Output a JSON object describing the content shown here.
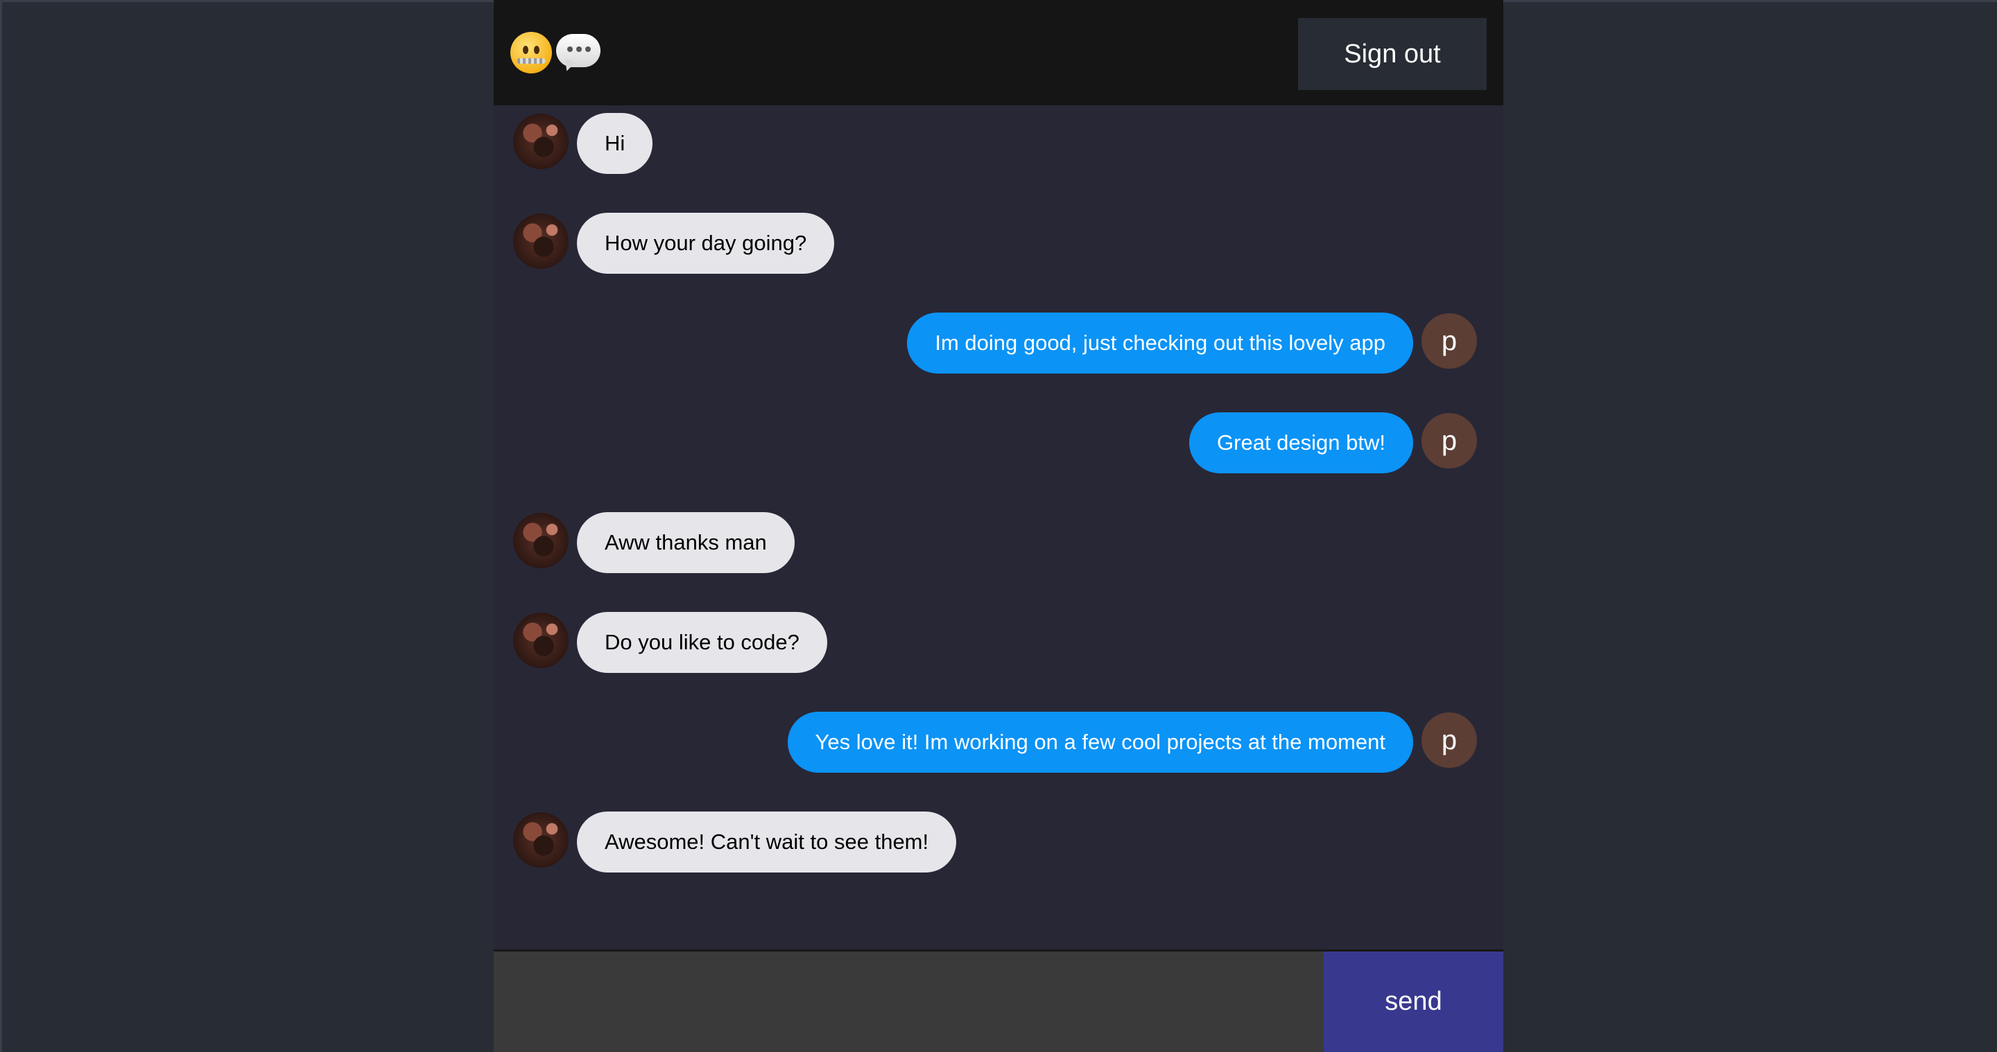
{
  "header": {
    "logo_icons": [
      "zipper-mouth-face-icon",
      "speech-bubble-icon"
    ],
    "signout_label": "Sign out"
  },
  "messages": [
    {
      "side": "received",
      "text": "Hi"
    },
    {
      "side": "received",
      "text": "How your day going?"
    },
    {
      "side": "sent",
      "text": "Im doing good, just checking out this lovely app",
      "avatar_letter": "p"
    },
    {
      "side": "sent",
      "text": "Great design btw!",
      "avatar_letter": "p"
    },
    {
      "side": "received",
      "text": "Aww thanks man"
    },
    {
      "side": "received",
      "text": "Do you like to code?"
    },
    {
      "side": "sent",
      "text": "Yes love it! Im working on a few cool projects at the moment",
      "avatar_letter": "p"
    },
    {
      "side": "received",
      "text": "Awesome! Can't wait to see them!"
    }
  ],
  "composer": {
    "input_value": "",
    "send_label": "send"
  },
  "colors": {
    "page_bg": "#282c34",
    "chat_bg": "#282736",
    "header_bg": "#151515",
    "received_bubble": "#e6e5ea",
    "sent_bubble": "#0b93f6",
    "send_button": "#38388f",
    "letter_avatar": "#5c3e35"
  }
}
